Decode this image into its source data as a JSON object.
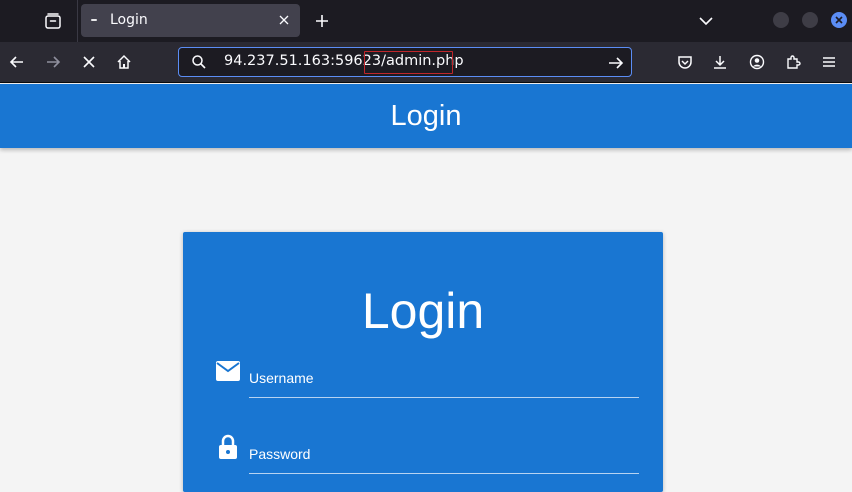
{
  "browser": {
    "tab": {
      "title": "Login"
    },
    "url": "94.237.51.163:59623/admin.php"
  },
  "page": {
    "header_title": "Login",
    "card": {
      "title": "Login",
      "username_placeholder": "Username",
      "password_placeholder": "Password"
    }
  },
  "colors": {
    "brand": "#1976d2",
    "highlight": "#c0262b"
  }
}
